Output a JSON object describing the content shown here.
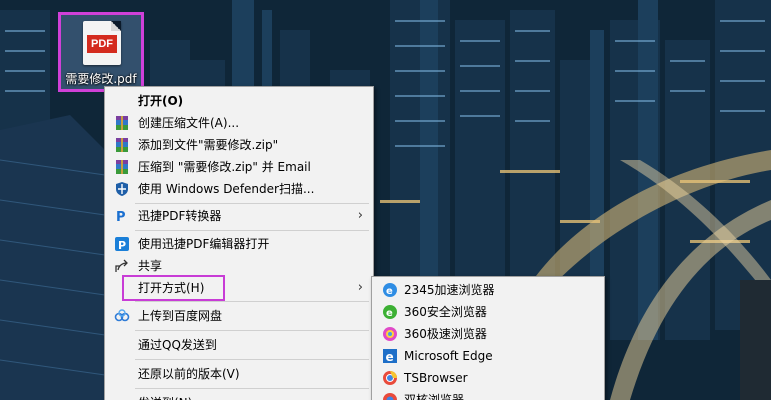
{
  "desktop": {
    "file_name": "需要修改.pdf",
    "file_badge": "PDF"
  },
  "context_menu": {
    "items": [
      {
        "label": "打开(O)"
      },
      {
        "label": "创建压缩文件(A)..."
      },
      {
        "label": "添加到文件\"需要修改.zip\""
      },
      {
        "label": "压缩到 \"需要修改.zip\" 并 Email"
      },
      {
        "label": "使用 Windows Defender扫描..."
      },
      {
        "label": "迅捷PDF转换器"
      },
      {
        "label": "使用迅捷PDF编辑器打开"
      },
      {
        "label": "共享"
      },
      {
        "label": "打开方式(H)"
      },
      {
        "label": "上传到百度网盘"
      },
      {
        "label": "通过QQ发送到"
      },
      {
        "label": "还原以前的版本(V)"
      },
      {
        "label": "发送到(N)"
      }
    ],
    "submenu_arrow": "›"
  },
  "open_with_menu": {
    "items": [
      {
        "label": "2345加速浏览器"
      },
      {
        "label": "360安全浏览器"
      },
      {
        "label": "360极速浏览器"
      },
      {
        "label": "Microsoft Edge"
      },
      {
        "label": "TSBrowser"
      },
      {
        "label": "双核浏览器"
      }
    ]
  },
  "colors": {
    "highlight": "#c83cd6",
    "pdf_red": "#d42b1e",
    "menu_bg": "#f2f2f2"
  }
}
